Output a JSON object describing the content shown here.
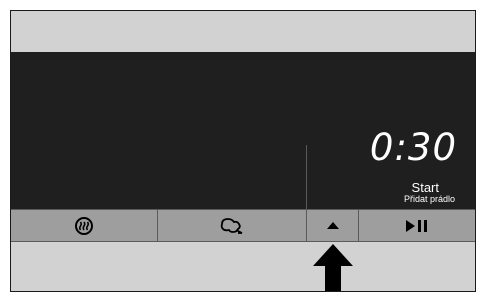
{
  "display": {
    "time": "0:30",
    "status": "Start",
    "substatus": "Přidat prádlo"
  },
  "buttons": [
    {
      "name": "steam",
      "icon": "steam-icon"
    },
    {
      "name": "stain",
      "icon": "stain-icon"
    },
    {
      "name": "up",
      "icon": "up-triangle-icon"
    },
    {
      "name": "start-pause",
      "icon": "play-pause-icon"
    }
  ],
  "pointer": {
    "icon": "up-arrow-icon"
  },
  "colors": {
    "panel": "#d2d2d2",
    "display": "#1f1f1f",
    "button_row": "#9e9e9e",
    "text_on_display": "#ffffff"
  }
}
